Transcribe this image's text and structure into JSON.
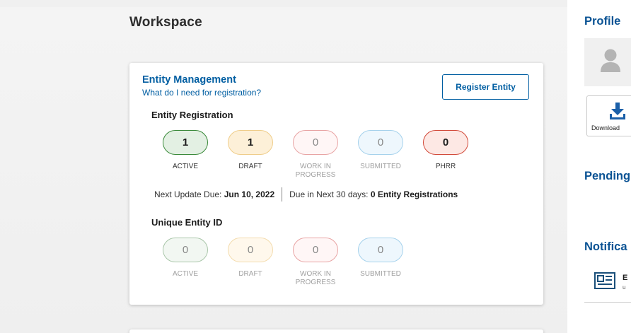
{
  "workspace": {
    "title": "Workspace"
  },
  "entity_card": {
    "title": "Entity Management",
    "help_link": "What do I need for registration?",
    "register_button": "Register Entity",
    "registration": {
      "label": "Entity Registration",
      "counts": [
        {
          "value": "1",
          "label": "ACTIVE"
        },
        {
          "value": "1",
          "label": "DRAFT"
        },
        {
          "value": "0",
          "label": "WORK IN PROGRESS"
        },
        {
          "value": "0",
          "label": "SUBMITTED"
        },
        {
          "value": "0",
          "label": "PHRR"
        }
      ]
    },
    "next_update_prefix": "Next Update Due:",
    "next_update_date": "Jun 10, 2022",
    "due_prefix": "Due in Next 30 days:",
    "due_value": "0 Entity Registrations",
    "uei": {
      "label": "Unique Entity ID",
      "counts": [
        {
          "value": "0",
          "label": "ACTIVE"
        },
        {
          "value": "0",
          "label": "DRAFT"
        },
        {
          "value": "0",
          "label": "WORK IN PROGRESS"
        },
        {
          "value": "0",
          "label": "SUBMITTED"
        }
      ]
    }
  },
  "sidebar": {
    "profile_title": "Profile",
    "download_label": "Download",
    "pending_title": "Pending",
    "notifications_title": "Notifica",
    "notification_item": {
      "title": "E",
      "subtitle": "u"
    }
  },
  "colors": {
    "link": "#005ea2",
    "sidebar_heading": "#0b5394",
    "active_border": "#3a8a3a",
    "draft_border": "#efcd8a",
    "wip_border": "#e8a4a4",
    "submitted_border": "#a6d2ec",
    "phrr_border": "#d24a3a"
  }
}
